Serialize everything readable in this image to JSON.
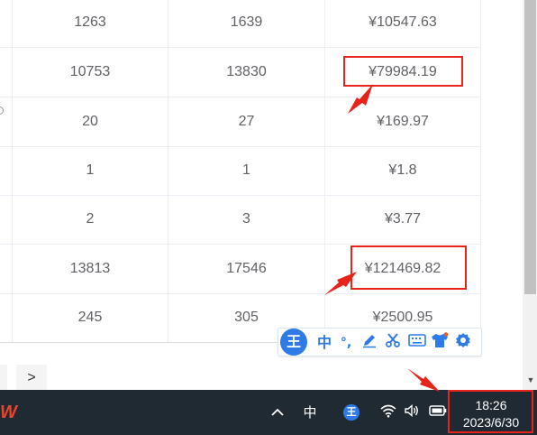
{
  "table": {
    "rows": [
      {
        "col1": "1263",
        "col2": "1639",
        "col3": "¥10547.63"
      },
      {
        "col1": "10753",
        "col2": "13830",
        "col3": "¥79984.19"
      },
      {
        "col1": "20",
        "col2": "27",
        "col3": "¥169.97"
      },
      {
        "col1": "1",
        "col2": "1",
        "col3": "¥1.8"
      },
      {
        "col1": "2",
        "col2": "3",
        "col3": "¥3.77"
      },
      {
        "col1": "13813",
        "col2": "17546",
        "col3": "¥121469.82"
      },
      {
        "col1": "245",
        "col2": "305",
        "col3": "¥2500.95"
      }
    ]
  },
  "pagination": {
    "next_label": ">"
  },
  "ime_toolbar": {
    "logo": "王",
    "mode_label": "中",
    "punct_label": "°,",
    "items": [
      "pen-icon",
      "scissors-icon",
      "keyboard-icon",
      "shirt-icon",
      "gear-icon"
    ]
  },
  "taskbar": {
    "chevron_label": "^",
    "ime_label": "中",
    "ime_logo": "王",
    "time": "18:26",
    "date": "2023/6/30"
  },
  "colors": {
    "annotation_red": "#e8231c",
    "ime_blue": "#2e7ae6",
    "taskbar_bg": "#1f2a33"
  }
}
